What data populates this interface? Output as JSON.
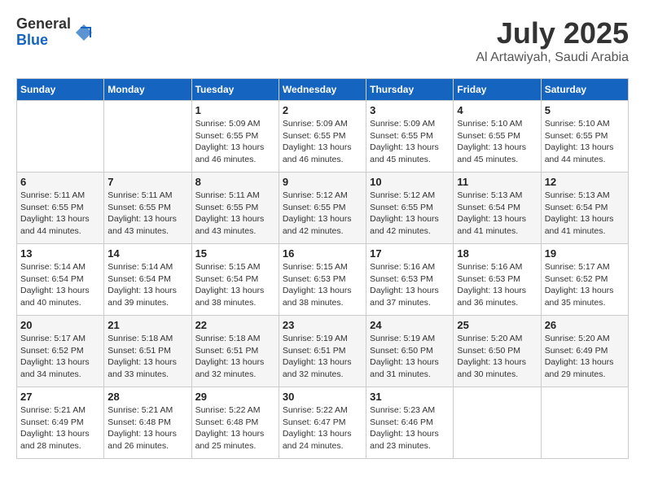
{
  "header": {
    "logo_general": "General",
    "logo_blue": "Blue",
    "month": "July 2025",
    "location": "Al Artawiyah, Saudi Arabia"
  },
  "weekdays": [
    "Sunday",
    "Monday",
    "Tuesday",
    "Wednesday",
    "Thursday",
    "Friday",
    "Saturday"
  ],
  "weeks": [
    [
      {
        "day": "",
        "sunrise": "",
        "sunset": "",
        "daylight": ""
      },
      {
        "day": "",
        "sunrise": "",
        "sunset": "",
        "daylight": ""
      },
      {
        "day": "1",
        "sunrise": "Sunrise: 5:09 AM",
        "sunset": "Sunset: 6:55 PM",
        "daylight": "Daylight: 13 hours and 46 minutes."
      },
      {
        "day": "2",
        "sunrise": "Sunrise: 5:09 AM",
        "sunset": "Sunset: 6:55 PM",
        "daylight": "Daylight: 13 hours and 46 minutes."
      },
      {
        "day": "3",
        "sunrise": "Sunrise: 5:09 AM",
        "sunset": "Sunset: 6:55 PM",
        "daylight": "Daylight: 13 hours and 45 minutes."
      },
      {
        "day": "4",
        "sunrise": "Sunrise: 5:10 AM",
        "sunset": "Sunset: 6:55 PM",
        "daylight": "Daylight: 13 hours and 45 minutes."
      },
      {
        "day": "5",
        "sunrise": "Sunrise: 5:10 AM",
        "sunset": "Sunset: 6:55 PM",
        "daylight": "Daylight: 13 hours and 44 minutes."
      }
    ],
    [
      {
        "day": "6",
        "sunrise": "Sunrise: 5:11 AM",
        "sunset": "Sunset: 6:55 PM",
        "daylight": "Daylight: 13 hours and 44 minutes."
      },
      {
        "day": "7",
        "sunrise": "Sunrise: 5:11 AM",
        "sunset": "Sunset: 6:55 PM",
        "daylight": "Daylight: 13 hours and 43 minutes."
      },
      {
        "day": "8",
        "sunrise": "Sunrise: 5:11 AM",
        "sunset": "Sunset: 6:55 PM",
        "daylight": "Daylight: 13 hours and 43 minutes."
      },
      {
        "day": "9",
        "sunrise": "Sunrise: 5:12 AM",
        "sunset": "Sunset: 6:55 PM",
        "daylight": "Daylight: 13 hours and 42 minutes."
      },
      {
        "day": "10",
        "sunrise": "Sunrise: 5:12 AM",
        "sunset": "Sunset: 6:55 PM",
        "daylight": "Daylight: 13 hours and 42 minutes."
      },
      {
        "day": "11",
        "sunrise": "Sunrise: 5:13 AM",
        "sunset": "Sunset: 6:54 PM",
        "daylight": "Daylight: 13 hours and 41 minutes."
      },
      {
        "day": "12",
        "sunrise": "Sunrise: 5:13 AM",
        "sunset": "Sunset: 6:54 PM",
        "daylight": "Daylight: 13 hours and 41 minutes."
      }
    ],
    [
      {
        "day": "13",
        "sunrise": "Sunrise: 5:14 AM",
        "sunset": "Sunset: 6:54 PM",
        "daylight": "Daylight: 13 hours and 40 minutes."
      },
      {
        "day": "14",
        "sunrise": "Sunrise: 5:14 AM",
        "sunset": "Sunset: 6:54 PM",
        "daylight": "Daylight: 13 hours and 39 minutes."
      },
      {
        "day": "15",
        "sunrise": "Sunrise: 5:15 AM",
        "sunset": "Sunset: 6:54 PM",
        "daylight": "Daylight: 13 hours and 38 minutes."
      },
      {
        "day": "16",
        "sunrise": "Sunrise: 5:15 AM",
        "sunset": "Sunset: 6:53 PM",
        "daylight": "Daylight: 13 hours and 38 minutes."
      },
      {
        "day": "17",
        "sunrise": "Sunrise: 5:16 AM",
        "sunset": "Sunset: 6:53 PM",
        "daylight": "Daylight: 13 hours and 37 minutes."
      },
      {
        "day": "18",
        "sunrise": "Sunrise: 5:16 AM",
        "sunset": "Sunset: 6:53 PM",
        "daylight": "Daylight: 13 hours and 36 minutes."
      },
      {
        "day": "19",
        "sunrise": "Sunrise: 5:17 AM",
        "sunset": "Sunset: 6:52 PM",
        "daylight": "Daylight: 13 hours and 35 minutes."
      }
    ],
    [
      {
        "day": "20",
        "sunrise": "Sunrise: 5:17 AM",
        "sunset": "Sunset: 6:52 PM",
        "daylight": "Daylight: 13 hours and 34 minutes."
      },
      {
        "day": "21",
        "sunrise": "Sunrise: 5:18 AM",
        "sunset": "Sunset: 6:51 PM",
        "daylight": "Daylight: 13 hours and 33 minutes."
      },
      {
        "day": "22",
        "sunrise": "Sunrise: 5:18 AM",
        "sunset": "Sunset: 6:51 PM",
        "daylight": "Daylight: 13 hours and 32 minutes."
      },
      {
        "day": "23",
        "sunrise": "Sunrise: 5:19 AM",
        "sunset": "Sunset: 6:51 PM",
        "daylight": "Daylight: 13 hours and 32 minutes."
      },
      {
        "day": "24",
        "sunrise": "Sunrise: 5:19 AM",
        "sunset": "Sunset: 6:50 PM",
        "daylight": "Daylight: 13 hours and 31 minutes."
      },
      {
        "day": "25",
        "sunrise": "Sunrise: 5:20 AM",
        "sunset": "Sunset: 6:50 PM",
        "daylight": "Daylight: 13 hours and 30 minutes."
      },
      {
        "day": "26",
        "sunrise": "Sunrise: 5:20 AM",
        "sunset": "Sunset: 6:49 PM",
        "daylight": "Daylight: 13 hours and 29 minutes."
      }
    ],
    [
      {
        "day": "27",
        "sunrise": "Sunrise: 5:21 AM",
        "sunset": "Sunset: 6:49 PM",
        "daylight": "Daylight: 13 hours and 28 minutes."
      },
      {
        "day": "28",
        "sunrise": "Sunrise: 5:21 AM",
        "sunset": "Sunset: 6:48 PM",
        "daylight": "Daylight: 13 hours and 26 minutes."
      },
      {
        "day": "29",
        "sunrise": "Sunrise: 5:22 AM",
        "sunset": "Sunset: 6:48 PM",
        "daylight": "Daylight: 13 hours and 25 minutes."
      },
      {
        "day": "30",
        "sunrise": "Sunrise: 5:22 AM",
        "sunset": "Sunset: 6:47 PM",
        "daylight": "Daylight: 13 hours and 24 minutes."
      },
      {
        "day": "31",
        "sunrise": "Sunrise: 5:23 AM",
        "sunset": "Sunset: 6:46 PM",
        "daylight": "Daylight: 13 hours and 23 minutes."
      },
      {
        "day": "",
        "sunrise": "",
        "sunset": "",
        "daylight": ""
      },
      {
        "day": "",
        "sunrise": "",
        "sunset": "",
        "daylight": ""
      }
    ]
  ]
}
